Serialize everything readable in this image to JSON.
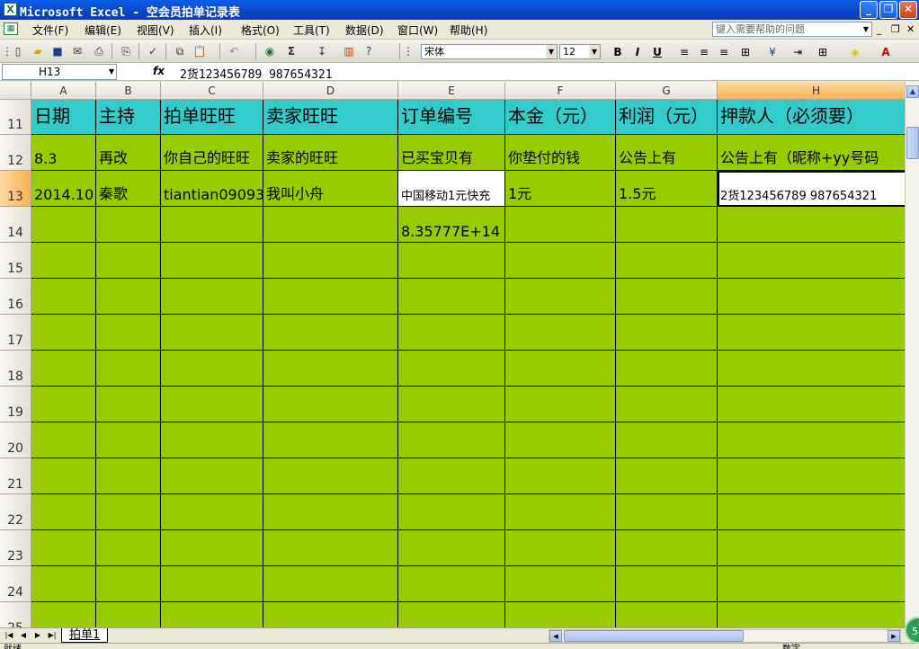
{
  "window": {
    "title": "Microsoft Excel - 空会员拍单记录表",
    "app_icon": "excel-icon"
  },
  "menu": [
    "文件(F)",
    "编辑(E)",
    "视图(V)",
    "插入(I)",
    "格式(O)",
    "工具(T)",
    "数据(D)",
    "窗口(W)",
    "帮助(H)"
  ],
  "help_box": {
    "placeholder": "键入需要帮助的问题"
  },
  "format": {
    "font": "宋体",
    "size": "12"
  },
  "formula_bar": {
    "name_box": "H13",
    "fx": "fx",
    "value": "2货123456789 987654321"
  },
  "columns": [
    "A",
    "B",
    "C",
    "D",
    "E",
    "F",
    "G",
    "H"
  ],
  "rows": [
    {
      "num": "11",
      "cells": [
        "日期",
        "主持",
        "拍单旺旺",
        "卖家旺旺",
        "订单编号",
        "本金（元）",
        "利润（元）",
        "押款人（必须要）"
      ]
    },
    {
      "num": "12",
      "cells": [
        "8.3",
        "再改",
        "你自己的旺旺",
        "卖家的旺旺",
        "已买宝贝有",
        "你垫付的钱",
        "公告上有",
        "公告上有（昵称+yy号码"
      ]
    },
    {
      "num": "13",
      "cells": [
        "2014.10",
        "秦歌",
        "tiantian09093",
        "我叫小舟",
        "中国移动1元快充",
        "1元",
        "1.5元",
        "2货123456789 987654321"
      ]
    },
    {
      "num": "14",
      "cells": [
        "",
        "",
        "",
        "",
        "8.35777E+14",
        "",
        "",
        ""
      ]
    },
    {
      "num": "15",
      "cells": [
        "",
        "",
        "",
        "",
        "",
        "",
        "",
        ""
      ]
    },
    {
      "num": "16",
      "cells": [
        "",
        "",
        "",
        "",
        "",
        "",
        "",
        ""
      ]
    },
    {
      "num": "17",
      "cells": [
        "",
        "",
        "",
        "",
        "",
        "",
        "",
        ""
      ]
    },
    {
      "num": "18",
      "cells": [
        "",
        "",
        "",
        "",
        "",
        "",
        "",
        ""
      ]
    },
    {
      "num": "19",
      "cells": [
        "",
        "",
        "",
        "",
        "",
        "",
        "",
        ""
      ]
    },
    {
      "num": "20",
      "cells": [
        "",
        "",
        "",
        "",
        "",
        "",
        "",
        ""
      ]
    },
    {
      "num": "21",
      "cells": [
        "",
        "",
        "",
        "",
        "",
        "",
        "",
        ""
      ]
    },
    {
      "num": "22",
      "cells": [
        "",
        "",
        "",
        "",
        "",
        "",
        "",
        ""
      ]
    },
    {
      "num": "23",
      "cells": [
        "",
        "",
        "",
        "",
        "",
        "",
        "",
        ""
      ]
    },
    {
      "num": "24",
      "cells": [
        "",
        "",
        "",
        "",
        "",
        "",
        "",
        ""
      ]
    },
    {
      "num": "25",
      "cells": [
        "",
        "",
        "",
        "",
        "",
        "",
        "",
        ""
      ]
    }
  ],
  "sheet_tab": "拍单1",
  "selected_cell": {
    "column": "H",
    "row": "13"
  },
  "colors": {
    "header_fill": "#33cccc",
    "body_fill": "#99cc00",
    "selection_header": "#f8b250"
  },
  "status": {
    "left": "就绪",
    "right": "数字"
  },
  "badge": "51"
}
